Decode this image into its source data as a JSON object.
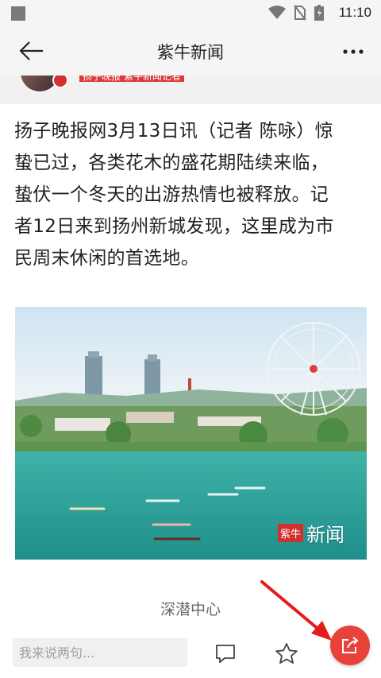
{
  "status_bar": {
    "time": "11:10"
  },
  "header": {
    "title": "紫牛新闻"
  },
  "author": {
    "tag": "扬子晚报 紫牛新闻记者"
  },
  "article": {
    "lines": [
      "扬子晚报网3月13日讯（记者 陈咏）惊",
      "蛰已过，各类花木的盛花期陆续来临，",
      "蛰伏一个冬天的出游热情也被释放。记",
      "者12日来到扬州新城发现，这里成为市",
      "民周末休闲的首选地。"
    ],
    "photo_watermark_logo": "紫牛",
    "photo_watermark_text": "新闻",
    "section_label": "深潜中心"
  },
  "bottom_bar": {
    "comment_placeholder": "我来说两句...",
    "accent_color": "#e8423a"
  },
  "icons": [
    "back-arrow-icon",
    "more-dots-icon",
    "wifi-icon",
    "no-sim-icon",
    "battery-icon",
    "comment-icon",
    "star-icon",
    "share-icon"
  ]
}
